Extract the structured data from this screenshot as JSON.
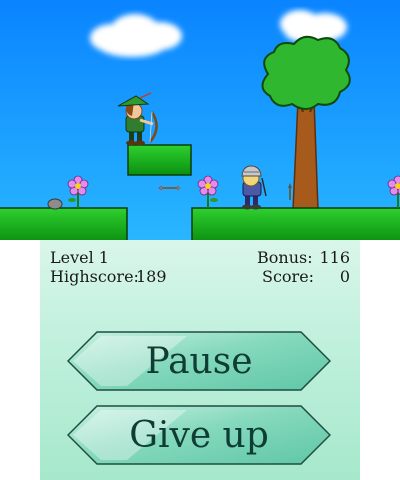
{
  "game": {
    "top_screen": {
      "scene": "platformer-level",
      "characters": [
        "archer",
        "helmet-soldier"
      ],
      "projectiles": [
        "arrow"
      ]
    },
    "hud": {
      "level_text": "Level 1",
      "highscore_label": "Highscore:",
      "highscore_value": "189",
      "bonus_label": "Bonus:",
      "bonus_value": "116",
      "score_label": "Score:",
      "score_value": "0"
    },
    "buttons": {
      "pause_label": "Pause",
      "give_up_label": "Give up"
    },
    "colors": {
      "sky": "#1c9cff",
      "grass": "#19b31b",
      "panel": "#bff0dc",
      "button": "#7fd6bb",
      "button_text": "#0f3d33"
    }
  }
}
